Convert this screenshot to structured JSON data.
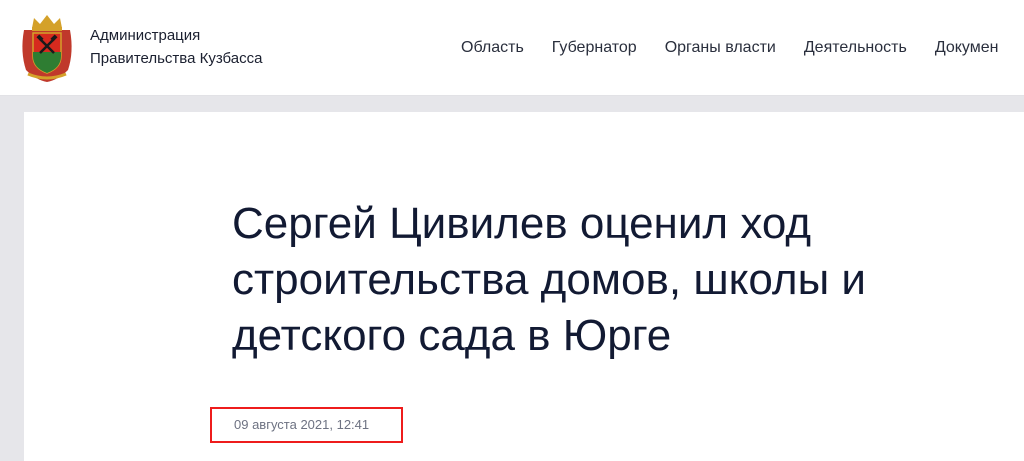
{
  "header": {
    "org_line1": "Администрация",
    "org_line2": "Правительства Кузбасса",
    "logo_icon": "kuzbass-coat-of-arms-icon",
    "nav": [
      {
        "label": "Область"
      },
      {
        "label": "Губернатор"
      },
      {
        "label": "Органы власти"
      },
      {
        "label": "Деятельность"
      },
      {
        "label": "Докумен"
      }
    ]
  },
  "article": {
    "title": "Сергей Цивилев оценил ход строительства домов, школы и детского сада в Юрге",
    "date": "09 августа 2021, 12:41"
  },
  "colors": {
    "accent_red": "#ee1c1c",
    "title_text": "#121a33",
    "background": "#e6e6ea"
  }
}
